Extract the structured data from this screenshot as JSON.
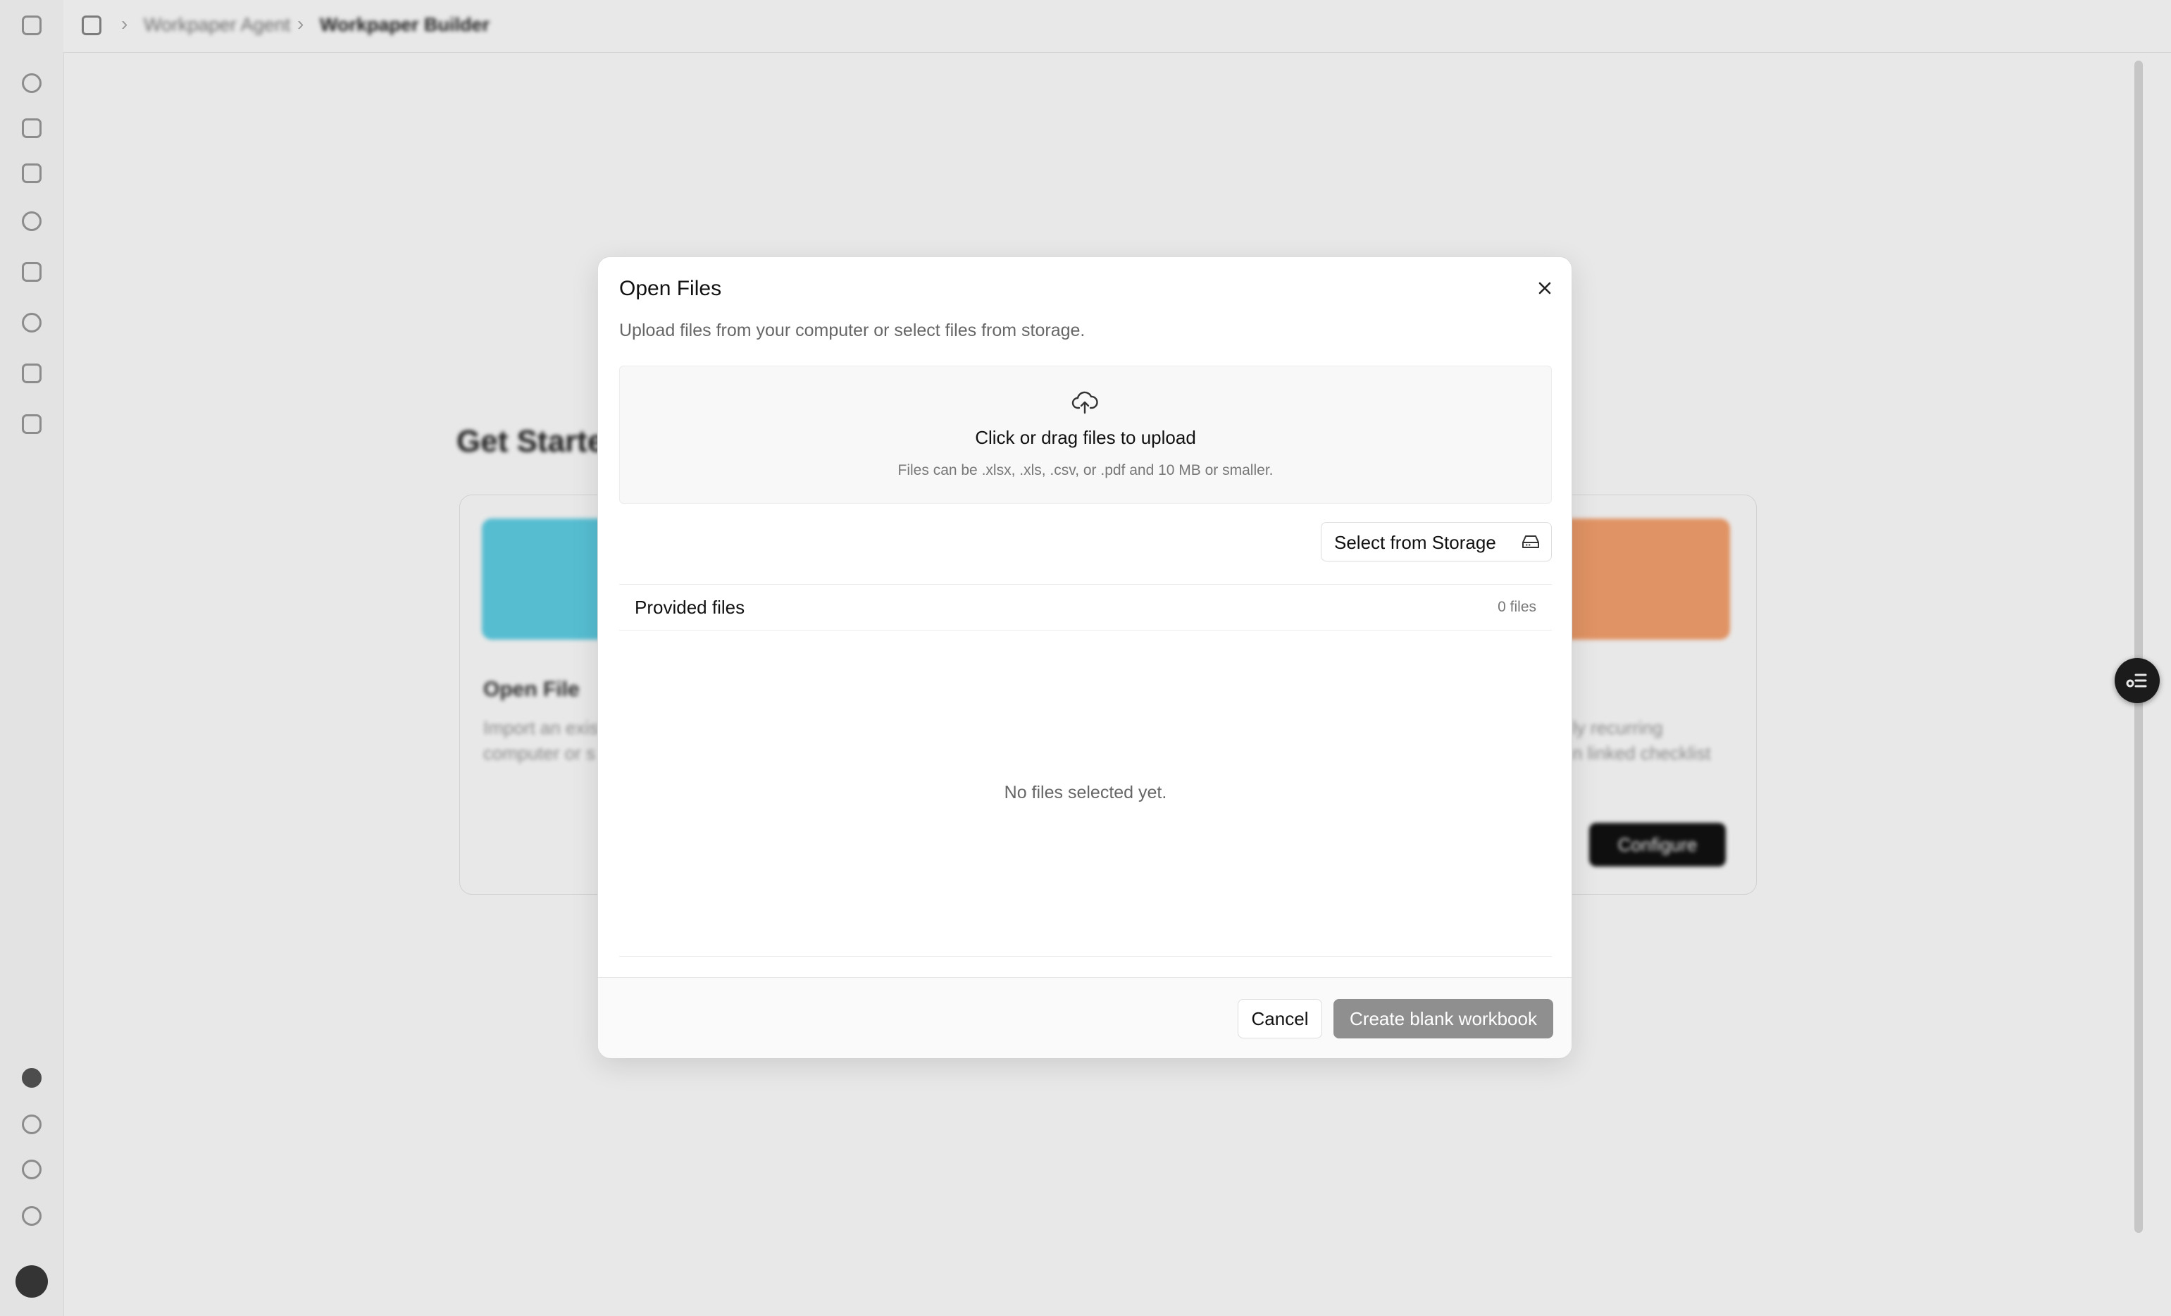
{
  "breadcrumb": {
    "items": [
      "Workpaper Agent",
      "Workpaper Builder"
    ]
  },
  "background": {
    "section_title": "Get Started",
    "card_left_title": "Open File",
    "card_left_lines": [
      "Import an existing",
      "computer or s"
    ],
    "card_right_lines": [
      "ly recurring",
      "n linked checklist"
    ],
    "configure_label": "Configure"
  },
  "modal": {
    "title": "Open Files",
    "description": "Upload files from your computer or select files from storage.",
    "dropzone_title": "Click or drag files to upload",
    "dropzone_hint": "Files can be .xlsx, .xls, .csv, or .pdf and 10 MB or smaller.",
    "select_storage_label": "Select from Storage",
    "files_header_label": "Provided files",
    "files_count": "0 files",
    "empty_message": "No files selected yet.",
    "cancel_label": "Cancel",
    "create_label": "Create blank workbook"
  },
  "icons": {
    "close": "close-icon",
    "upload": "cloud-upload-icon",
    "storage": "hard-drive-icon"
  },
  "colors": {
    "primary_disabled": "#8f8f8f",
    "overlay": "rgba(0,0,0,0.09)",
    "accent_cyan": "#5fd0e6",
    "accent_orange": "#f7a26e"
  }
}
